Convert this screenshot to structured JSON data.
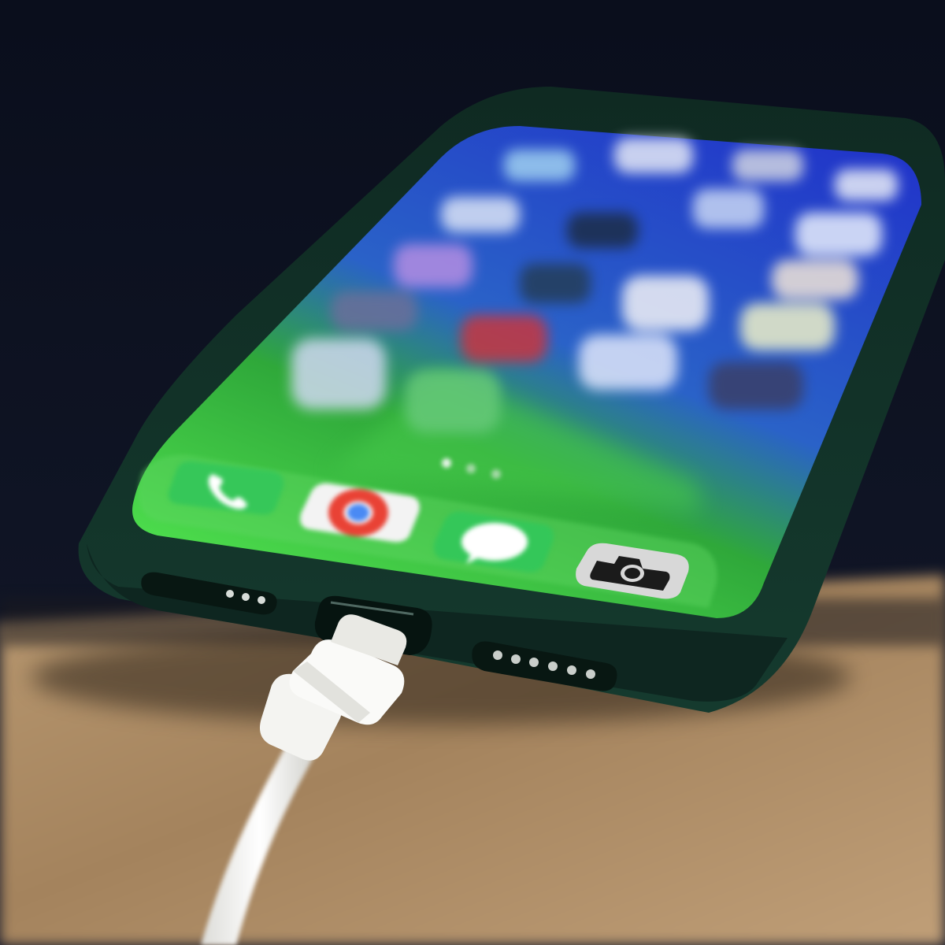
{
  "scene": {
    "subject": "smartphone-charging",
    "colors": {
      "background_dark": "#0b0f1d",
      "surface_tan": "#a98964",
      "case_green": "#123027",
      "screen_green": "#3fcb45",
      "screen_blue": "#2f3fd8",
      "cable_white": "#f1f1ee"
    }
  },
  "home_screen": {
    "page_dots": {
      "count": 3,
      "active_index": 0
    },
    "dock": [
      {
        "icon": "phone-icon",
        "color": "#34c759"
      },
      {
        "icon": "chrome-icon",
        "color": "#f2f2f2"
      },
      {
        "icon": "messages-icon",
        "color": "#34c759"
      },
      {
        "icon": "camera-icon",
        "color": "#d9d9d9"
      }
    ]
  },
  "hardware": {
    "left_speaker_holes": 3,
    "right_speaker_holes": 6,
    "port": "charging-port-icon"
  }
}
